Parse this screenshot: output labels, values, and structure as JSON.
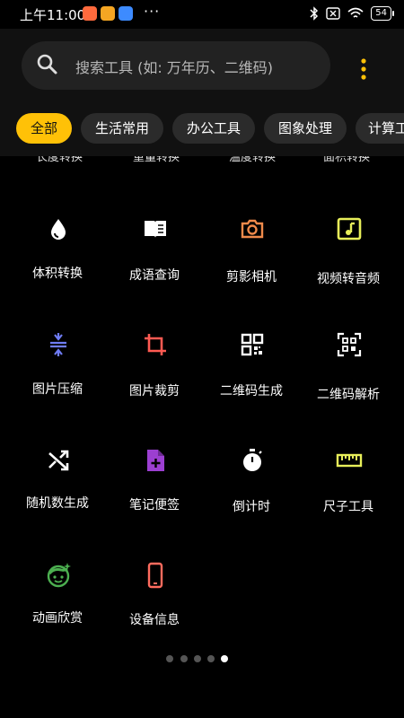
{
  "status": {
    "time": "上午11:00",
    "dots": "···",
    "battery": "54"
  },
  "search": {
    "placeholder": "搜索工具 (如: 万年历、二维码)"
  },
  "chips": [
    "全部",
    "生活常用",
    "办公工具",
    "图象处理",
    "计算工"
  ],
  "cut_row": [
    "长度转换",
    "重量转换",
    "温度转换",
    "面积转换"
  ],
  "tools": [
    {
      "label": "体积转换",
      "icon": "water-drop-icon",
      "color": "#ffffff"
    },
    {
      "label": "成语查询",
      "icon": "book-icon",
      "color": "#ffffff"
    },
    {
      "label": "剪影相机",
      "icon": "camera-icon",
      "color": "#f08a4b"
    },
    {
      "label": "视频转音频",
      "icon": "music-note-icon",
      "color": "#e8ef5a"
    },
    {
      "label": "图片压缩",
      "icon": "compress-icon",
      "color": "#6f7cf5"
    },
    {
      "label": "图片裁剪",
      "icon": "crop-icon",
      "color": "#ff5a52"
    },
    {
      "label": "二维码生成",
      "icon": "qr-code-icon",
      "color": "#ffffff"
    },
    {
      "label": "二维码解析",
      "icon": "qr-scan-icon",
      "color": "#ffffff"
    },
    {
      "label": "随机数生成",
      "icon": "shuffle-icon",
      "color": "#ffffff"
    },
    {
      "label": "笔记便签",
      "icon": "note-add-icon",
      "color": "#9c3fd1"
    },
    {
      "label": "倒计时",
      "icon": "timer-icon",
      "color": "#ffffff"
    },
    {
      "label": "尺子工具",
      "icon": "ruler-icon",
      "color": "#e8ef5a"
    },
    {
      "label": "动画欣赏",
      "icon": "face-icon",
      "color": "#4caf50"
    },
    {
      "label": "设备信息",
      "icon": "phone-icon",
      "color": "#ff6b5e"
    }
  ],
  "pager": {
    "count": 5,
    "active": 4
  },
  "colors": {
    "accent": "#ffc107",
    "chip_bg": "#2b2b2b",
    "header_bg": "#111111"
  }
}
